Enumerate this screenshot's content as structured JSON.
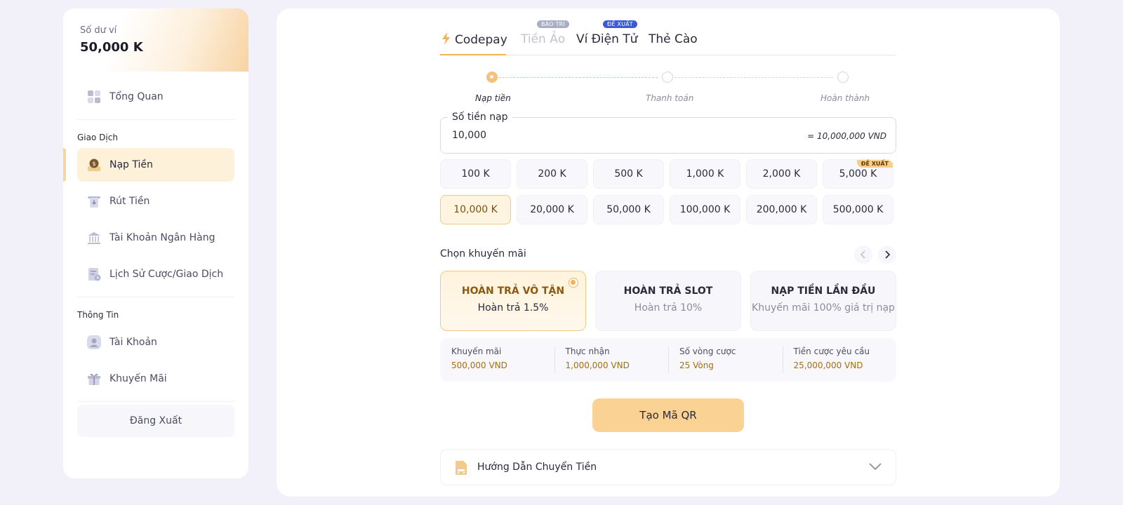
{
  "sidebar": {
    "balance_label": "Số dư ví",
    "balance_value": "50,000 K",
    "overview": "Tổng Quan",
    "section_transactions": "Giao Dịch",
    "deposit": "Nạp Tiền",
    "withdraw": "Rút Tiền",
    "bank_account": "Tài Khoản Ngân Hàng",
    "history": "Lịch Sử Cược/Giao Dịch",
    "section_info": "Thông Tin",
    "account": "Tài Khoản",
    "promotions": "Khuyến Mãi",
    "logout": "Đăng Xuất"
  },
  "tabs": {
    "codepay": "Codepay",
    "crypto": "Tiền Ảo",
    "crypto_badge": "BẢO TRÌ",
    "ewallet": "Ví Điện Tử",
    "ewallet_badge": "ĐỀ XUẤT",
    "card": "Thẻ Cào",
    "active": "Codepay"
  },
  "stepper": {
    "step1": "Nạp tiền",
    "step2": "Thanh toán",
    "step3": "Hoàn thành",
    "current": 1
  },
  "amount": {
    "label": "Số tiền nạp",
    "value": "10,000",
    "converted": "= 10,000,000 VND"
  },
  "presets": {
    "p1": "100 K",
    "p2": "200 K",
    "p3": "500 K",
    "p4": "1,000 K",
    "p5": "2,000 K",
    "p6": "5,000 K",
    "p7": "10,000 K",
    "p8": "20,000 K",
    "p9": "50,000 K",
    "p10": "100,000 K",
    "p11": "200,000 K",
    "p12": "500,000 K",
    "recommended_badge": "ĐỀ XUẤT",
    "selected": "10,000 K"
  },
  "promo": {
    "title": "Chọn khuyến mãi",
    "c1_title": "HOÀN TRẢ VÔ TẬN",
    "c1_sub": "Hoàn trả 1.5%",
    "c2_title": "HOÀN TRẢ SLOT",
    "c2_sub": "Hoàn trả 10%",
    "c3_title": "NẠP TIỀN LẦN ĐẦU",
    "c3_sub": "Khuyến mãi 100% giá trị nạp",
    "selected": "HOÀN TRẢ VÔ TẬN"
  },
  "summary": {
    "l1": "Khuyến mãi",
    "v1": "500,000 VND",
    "l2": "Thực nhận",
    "v2": "1,000,000 VND",
    "l3": "Số vòng cược",
    "v3": "25 Vòng",
    "l4": "Tiền cược yêu cầu",
    "v4": "25,000,000 VND"
  },
  "qr_button": "Tạo Mã QR",
  "guide": "Hướng Dẫn Chuyển Tiền",
  "colors": {
    "accent": "#f0b35a",
    "accent_light": "#fdf1d9",
    "value_text": "#a66d10",
    "badge_maintenance": "#a9aec7",
    "badge_recommended": "#3b5bd6"
  },
  "icons": {
    "overview": "dashboard-icon",
    "deposit": "coin-deposit-icon",
    "withdraw": "withdraw-icon",
    "bank_account": "bank-icon",
    "history": "history-document-icon",
    "account": "user-icon",
    "promotions": "gift-icon",
    "codepay_tab": "lightning-icon",
    "guide": "document-icon"
  }
}
